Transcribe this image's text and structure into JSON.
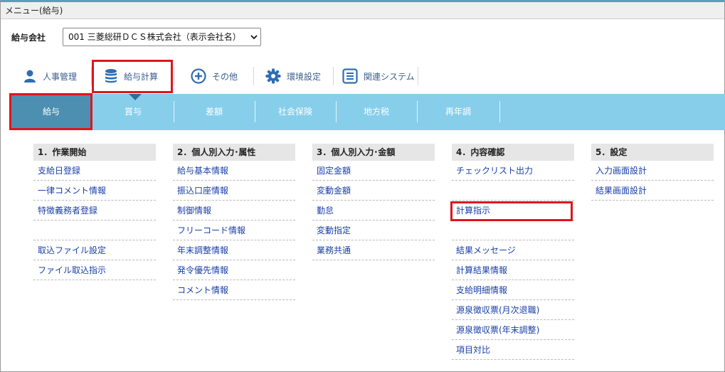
{
  "window": {
    "title": "メニュー(給与)"
  },
  "company": {
    "label": "給与会社",
    "selected": "001 三菱総研ＤＣＳ株式会社（表示会社名）"
  },
  "top_tabs": [
    {
      "label": "人事管理",
      "icon": "person-icon"
    },
    {
      "label": "給与計算",
      "icon": "database-icon"
    },
    {
      "label": "その他",
      "icon": "plus-circle-icon"
    },
    {
      "label": "環境設定",
      "icon": "gear-icon"
    },
    {
      "label": "関連システム",
      "icon": "list-icon"
    }
  ],
  "sub_tabs": [
    "給与",
    "賞与",
    "差額",
    "社会保険",
    "地方税",
    "再年調"
  ],
  "columns": [
    {
      "heading": "1．作業開始",
      "items": [
        "支給日登録",
        "一律コメント情報",
        "特徴義務者登録",
        "",
        "取込ファイル設定",
        "ファイル取込指示"
      ]
    },
    {
      "heading": "2．個人別入力･属性",
      "items": [
        "給与基本情報",
        "振込口座情報",
        "制御情報",
        "フリーコード情報",
        "年末調整情報",
        "発令優先情報",
        "コメント情報"
      ]
    },
    {
      "heading": "3．個人別入力･金額",
      "items": [
        "固定金額",
        "変動金額",
        "勤怠",
        "変動指定",
        "業務共通"
      ]
    },
    {
      "heading": "4．内容確認",
      "items": [
        "チェックリスト出力",
        "",
        "計算指示",
        "",
        "結果メッセージ",
        "計算結果情報",
        "支給明細情報",
        "源泉徴収票(月次退職)",
        "源泉徴収票(年末調整)",
        "項目対比"
      ]
    },
    {
      "heading": "5．設定",
      "items": [
        "入力画面設計",
        "結果画面設計"
      ]
    }
  ],
  "colors": {
    "accent_blue": "#87ceeb",
    "active_tab": "#4c8fb0",
    "highlight": "#e0141e",
    "link": "#1a3fa8"
  }
}
